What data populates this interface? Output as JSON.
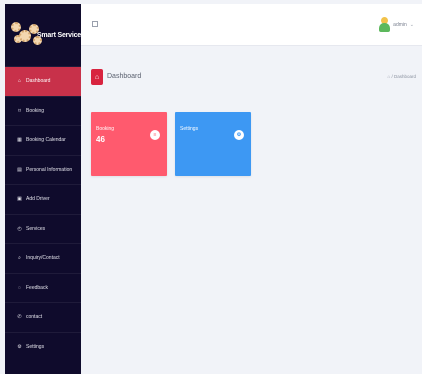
{
  "brand": {
    "name": "Smart Service"
  },
  "sidebar": {
    "items": [
      {
        "label": "Dashboard",
        "icon": "home-icon",
        "glyph": "⌂",
        "active": true
      },
      {
        "label": "Booking",
        "icon": "bookmark-icon",
        "glyph": "⌑",
        "active": false
      },
      {
        "label": "Booking Calendar",
        "icon": "calendar-icon",
        "glyph": "▦",
        "active": false
      },
      {
        "label": "Personal Information",
        "icon": "id-card-icon",
        "glyph": "▤",
        "active": false
      },
      {
        "label": "Add Driver",
        "icon": "driver-card-icon",
        "glyph": "▣",
        "active": false
      },
      {
        "label": "Services",
        "icon": "services-icon",
        "glyph": "◴",
        "active": false
      },
      {
        "label": "Inquiry/Contact",
        "icon": "inquiry-icon",
        "glyph": "⌕",
        "active": false
      },
      {
        "label": "Feedback",
        "icon": "feedback-icon",
        "glyph": "◌",
        "active": false
      },
      {
        "label": "contact",
        "icon": "phone-icon",
        "glyph": "✆",
        "active": false
      },
      {
        "label": "Settings",
        "icon": "gear-icon",
        "glyph": "⚙",
        "active": false
      }
    ]
  },
  "topbar": {
    "expand_icon": "fullscreen-icon",
    "user_name": "admin",
    "caret": "⌄"
  },
  "page": {
    "title": "Dashboard",
    "icon_glyph": "⌂",
    "breadcrumb_icon": "⌂",
    "breadcrumb_text": " / Dashboard"
  },
  "cards": {
    "booking": {
      "label": "Booking",
      "value": "46",
      "icon": "booking-list-icon",
      "glyph": "≡",
      "color": "#ff5a6e"
    },
    "settings": {
      "label": "Settings",
      "icon": "settings-gear-icon",
      "glyph": "⚙",
      "color": "#3d98f3"
    }
  },
  "colors": {
    "sidebar_bg": "#0f0b2c",
    "active_item": "#c8314a",
    "page_bg": "#f1f3f8",
    "accent_red": "#d8233f"
  }
}
